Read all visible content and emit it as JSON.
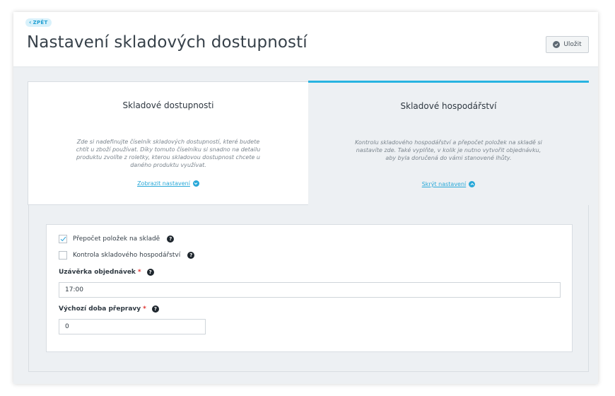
{
  "header": {
    "back_label": "ZPĚT",
    "title": "Nastavení skladových dostupností",
    "save_label": "Uložit"
  },
  "cards": [
    {
      "title": "Skladové dostupnosti",
      "description": "Zde si nadefinujte číselník skladových dostupností, které budete chtít u zboží používat. Díky tomuto číselníku si snadno na detailu produktu zvolíte z roletky, kterou skladovou dostupnost chcete u daného produktu využívat.",
      "link_label": "Zobrazit nastavení"
    },
    {
      "title": "Skladové hospodářství",
      "description": "Kontrolu skladového hospodářství a přepočet položek na skladě si nastavíte zde. Také vyplňte, v kolik je nutno vytvořit objednávku, aby byla doručená do vámi stanovené lhůty.",
      "link_label": "Skrýt nastavení"
    }
  ],
  "form": {
    "checkbox_recalc": {
      "label": "Přepočet položek na skladě",
      "checked": true
    },
    "checkbox_control": {
      "label": "Kontrola skladového hospodářství",
      "checked": false
    },
    "cutoff": {
      "label": "Uzávěrka objednávek",
      "required_mark": "*",
      "value": "17:00"
    },
    "shipping": {
      "label": "Výchozí doba přepravy",
      "required_mark": "*",
      "value": "0"
    },
    "help_glyph": "?"
  },
  "colors": {
    "accent": "#28b3e1",
    "link": "#28a8d8",
    "required": "#e0312d"
  }
}
